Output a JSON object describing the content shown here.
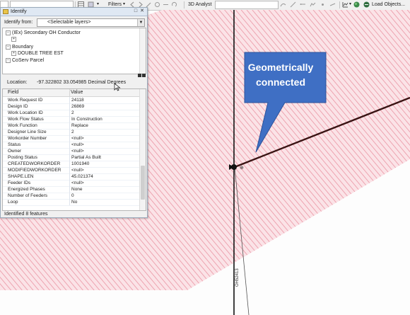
{
  "toolbar": {
    "filters_label": "Filters",
    "analyst_label": "3D Analyst",
    "load_objects_label": "Load Objects..."
  },
  "identify": {
    "title": "Identify",
    "identify_from_label": "Identify from:",
    "identify_from_value": "<Selectable layers>",
    "tree": [
      {
        "label": "(IEx) Secondary OH Conductor",
        "indent": 0
      },
      {
        "label": "",
        "indent": 1
      },
      {
        "label": "Boundary",
        "indent": 0
      },
      {
        "label": "DOUBLE TREE EST",
        "indent": 1
      },
      {
        "label": "CoServ Parcel",
        "indent": 0
      }
    ],
    "location_label": "Location:",
    "location_value": "-97.322802  33.054985 Decimal Degrees",
    "columns": {
      "field": "Field",
      "value": "Value"
    },
    "rows": [
      {
        "field": "Work Request ID",
        "value": "24118"
      },
      {
        "field": "Design ID",
        "value": "26869"
      },
      {
        "field": "Work Location ID",
        "value": "2"
      },
      {
        "field": "Work Flow Status",
        "value": "In Construction"
      },
      {
        "field": "Work Function",
        "value": "Replace"
      },
      {
        "field": "Designer Line Size",
        "value": "2"
      },
      {
        "field": "Workorder Number",
        "value": "<null>"
      },
      {
        "field": "Status",
        "value": "<null>"
      },
      {
        "field": "Owner",
        "value": "<null>"
      },
      {
        "field": "Posting Status",
        "value": "Partial As Built"
      },
      {
        "field": "CREATEDWORKORDER",
        "value": "1001940"
      },
      {
        "field": "MODIFIEDWORKORDER",
        "value": "<null>"
      },
      {
        "field": "SHAPE.LEN",
        "value": "45.021374"
      },
      {
        "field": "Feeder IDs",
        "value": "<null>"
      },
      {
        "field": "Energized Phases",
        "value": "None"
      },
      {
        "field": "Number of Feeders",
        "value": "0"
      },
      {
        "field": "Loop",
        "value": "No"
      }
    ],
    "status_text": "Identified 8 features"
  },
  "map": {
    "callout_line1": "Geometrically",
    "callout_line2": "connected",
    "line_label": "OH52413",
    "callout_color": "#3f6fc4",
    "hatch_color": "#e88a9a",
    "hatch_fill": "#fbe3e7"
  }
}
